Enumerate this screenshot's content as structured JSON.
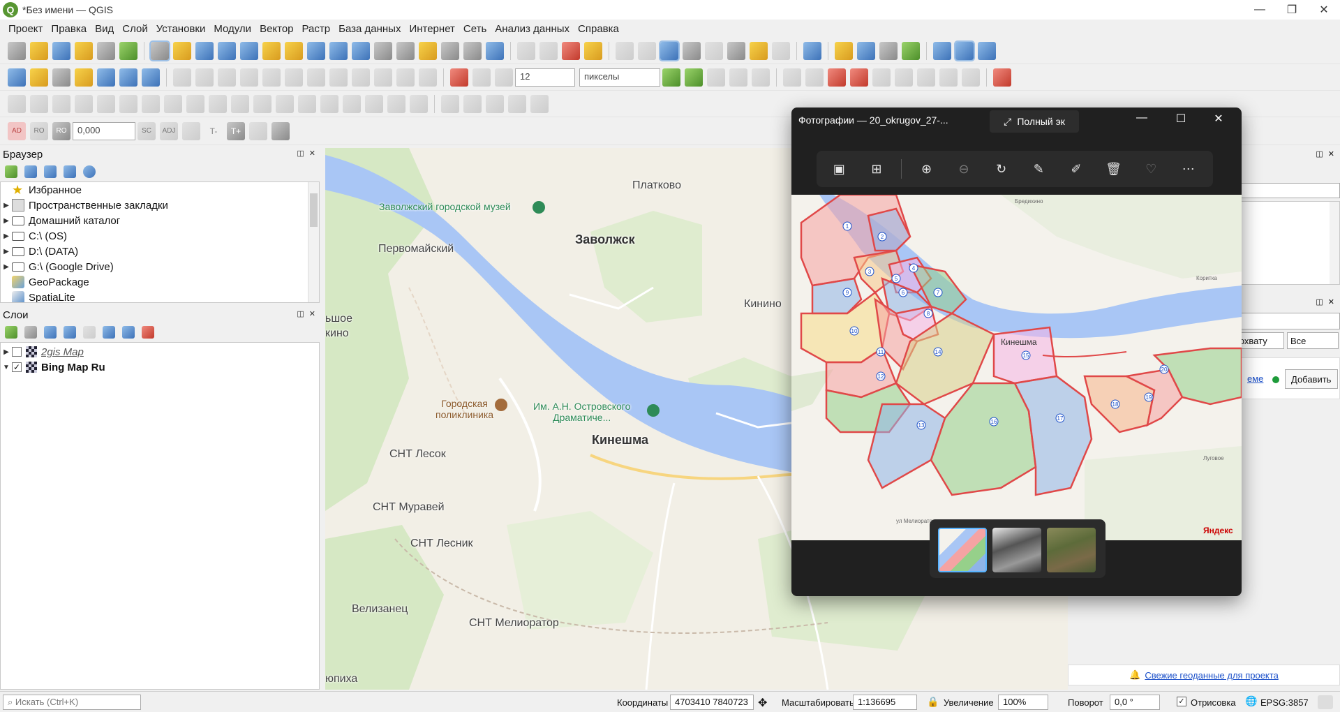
{
  "app": {
    "title": "*Без имени — QGIS"
  },
  "menu": [
    "Проект",
    "Правка",
    "Вид",
    "Слой",
    "Установки",
    "Модули",
    "Вектор",
    "Растр",
    "База данных",
    "Интернет",
    "Сеть",
    "Анализ данных",
    "Справка"
  ],
  "toolbar": {
    "size_value": "12",
    "units": "пикселы",
    "offset_value": "0,000",
    "adj_labels": [
      "AD",
      "RO",
      "RO",
      "SC",
      "ADJ"
    ],
    "t_labels": [
      "T-",
      "T+"
    ]
  },
  "browser": {
    "title": "Браузер",
    "items": [
      {
        "label": "Избранное",
        "icon": "star-icon",
        "expander": false
      },
      {
        "label": "Пространственные закладки",
        "icon": "bookmark-icon",
        "expander": true
      },
      {
        "label": "Домашний каталог",
        "icon": "home-folder-icon",
        "expander": true
      },
      {
        "label": "C:\\ (OS)",
        "icon": "folder-icon",
        "expander": true
      },
      {
        "label": "D:\\ (DATA)",
        "icon": "folder-icon",
        "expander": true
      },
      {
        "label": "G:\\ (Google Drive)",
        "icon": "folder-icon",
        "expander": true
      },
      {
        "label": "GeoPackage",
        "icon": "geopackage-icon",
        "expander": false
      },
      {
        "label": "SpatiaLite",
        "icon": "spatialite-icon",
        "expander": false
      }
    ]
  },
  "layers": {
    "title": "Слои",
    "items": [
      {
        "name": "2gis Map",
        "checked": false
      },
      {
        "name": "Bing Map Ru",
        "checked": true
      }
    ]
  },
  "map": {
    "labels": {
      "platkovo": "Платково",
      "museum": "Заволжский городской музей",
      "pervomaisky": "Первомайский",
      "zavolzhsk": "Заволжск",
      "kinino": "Кинино",
      "shoe": "ьшое",
      "kino": "кино",
      "poly1": "Городская",
      "poly2": "поликлиника",
      "theatre1": "Им. А.Н. Островского",
      "theatre2": "Драматиче...",
      "kineshma": "Кинешма",
      "lesok": "СНТ Лесок",
      "muravei": "СНТ Муравей",
      "lesnik": "СНТ Лесник",
      "velizanec": "Велизанец",
      "meliorator": "СНТ Мелиоратор",
      "yupiha": "юпиха"
    }
  },
  "photos": {
    "title": "Фотографии — 20_okrugov_27-...",
    "fullscreen": "Полный эк",
    "map_labels": {
      "kineshma": "Кинешма",
      "yandex": "Яндекс",
      "bredikhino": "Бредихино",
      "koritka": "Коритка",
      "lugovoe": "Луговое",
      "meliorator": "ул Мелиоратор"
    },
    "districts": [
      "1",
      "2",
      "3",
      "4",
      "5",
      "6",
      "7",
      "8",
      "9",
      "10",
      "11",
      "12",
      "13",
      "14",
      "15",
      "16",
      "17",
      "18",
      "19",
      "20"
    ],
    "thumbs": [
      "map-thumb",
      "satellite-bw-thumb",
      "satellite-color-thumb"
    ]
  },
  "right_panel": {
    "extent_btn": "о охвату",
    "select_value": "Все",
    "link_text": "еме",
    "add_button": "Добавить",
    "news_link": "Свежие геоданные для проекта"
  },
  "status": {
    "search_placeholder": "Искать (Ctrl+K)",
    "coords_label": "Координаты",
    "coords_value": "4703410 7840723",
    "scale_label": "Масштабировать",
    "scale_value": "1:136695",
    "magnifier_label": "Увеличение",
    "magnifier_value": "100%",
    "rotation_label": "Поворот",
    "rotation_value": "0,0 °",
    "render_label": "Отрисовка",
    "crs": "EPSG:3857"
  },
  "colors": {
    "river": "#a9c6f5",
    "forest": "#d6e8c4",
    "qgis_green": "#589632",
    "district_red": "#e05050"
  }
}
